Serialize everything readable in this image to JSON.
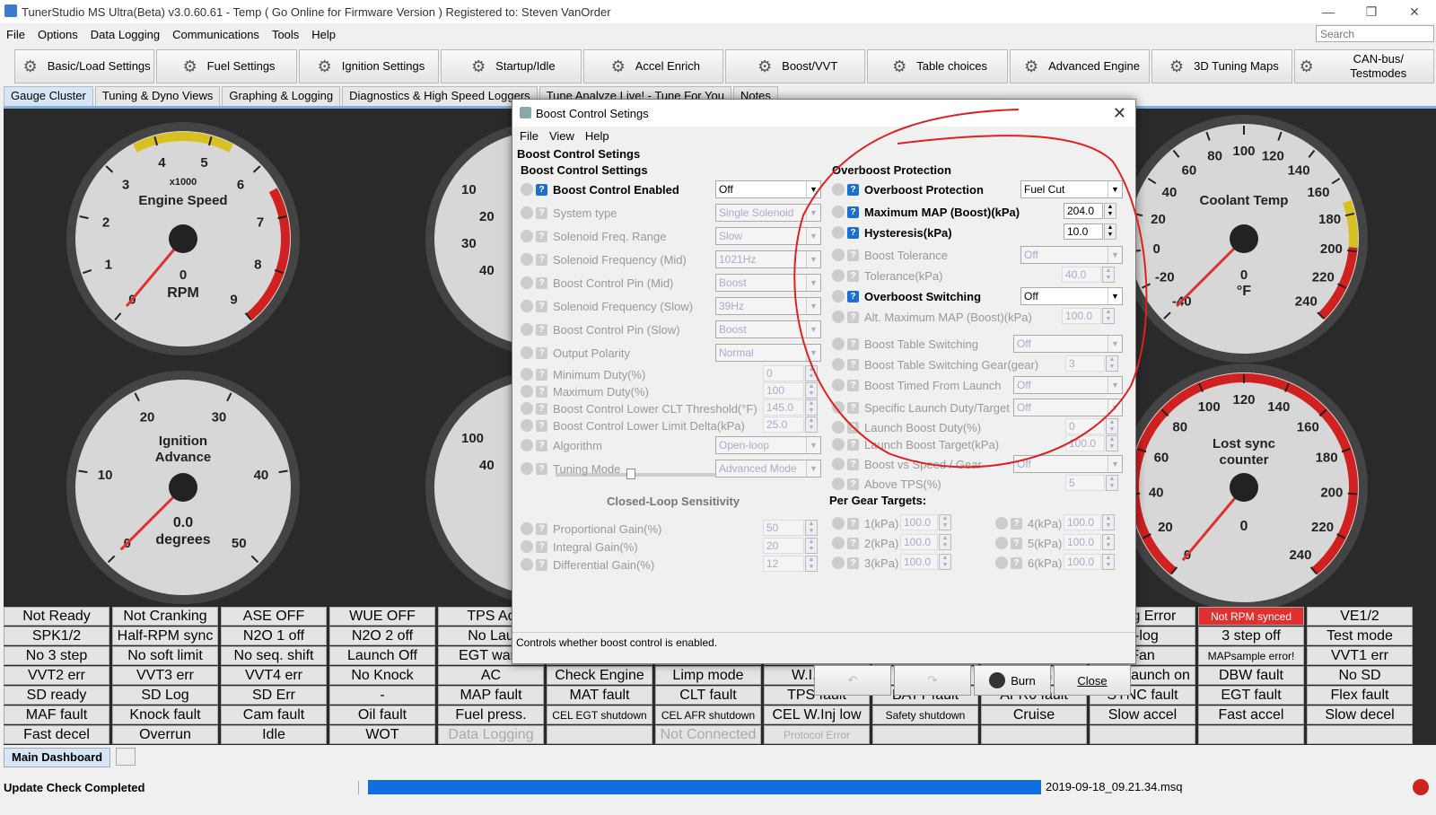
{
  "window": {
    "title": "TunerStudio MS Ultra(Beta) v3.0.60.61 - Temp ( Go Online for Firmware Version ) Registered to: Steven VanOrder",
    "minimize": "—",
    "restore": "❐",
    "close": "✕"
  },
  "menu": [
    "File",
    "Options",
    "Data Logging",
    "Communications",
    "Tools",
    "Help"
  ],
  "search_placeholder": "Search",
  "toolbar": [
    {
      "label": "Basic/Load Settings",
      "icon": "gears-icon"
    },
    {
      "label": "Fuel Settings",
      "icon": "injector-icon"
    },
    {
      "label": "Ignition Settings",
      "icon": "spark-plug-icon"
    },
    {
      "label": "Startup/Idle",
      "icon": "gauge-icon"
    },
    {
      "label": "Accel Enrich",
      "icon": "accel-icon"
    },
    {
      "label": "Boost/VVT",
      "icon": "turbo-icon"
    },
    {
      "label": "Table choices",
      "icon": "table-icon"
    },
    {
      "label": "Advanced Engine",
      "icon": "gear-icon"
    },
    {
      "label": "3D Tuning Maps",
      "icon": "wrench-icon"
    },
    {
      "label": "CAN-bus/ Testmodes",
      "icon": "network-icon"
    }
  ],
  "tabs": [
    "Gauge Cluster",
    "Tuning & Dyno Views",
    "Graphing & Logging",
    "Diagnostics & High Speed Loggers",
    "Tune Analyze Live! - Tune For You",
    "Notes"
  ],
  "gauges": {
    "rpm": {
      "title": "Engine Speed",
      "mult": "x1000",
      "value": "0",
      "unit": "RPM",
      "ticks": [
        "0",
        "1",
        "2",
        "3",
        "4",
        "5",
        "6",
        "7",
        "8",
        "9"
      ]
    },
    "advance": {
      "title": "Ignition Advance",
      "value": "0.0",
      "unit": "degrees",
      "ticks": [
        "0",
        "10",
        "20",
        "30",
        "40",
        "50"
      ]
    },
    "coolant": {
      "title": "Coolant Temp",
      "value": "0",
      "unit": "°F",
      "ticks": [
        "-40",
        "-20",
        "0",
        "20",
        "40",
        "60",
        "80",
        "100",
        "120",
        "140",
        "160",
        "180",
        "200",
        "220",
        "240"
      ]
    },
    "lostsync": {
      "title": "Lost sync counter",
      "value": "0",
      "ticks": [
        "0",
        "20",
        "40",
        "60",
        "80",
        "100",
        "120",
        "140",
        "160",
        "180",
        "200",
        "220",
        "240"
      ]
    },
    "partial_left_top": {
      "ticks": [
        "10",
        "20",
        "30",
        "40"
      ]
    },
    "partial_left_bottom": {
      "ticks": [
        "100",
        "40"
      ]
    }
  },
  "indicators": [
    [
      "Not Ready",
      "Not Cranking",
      "ASE OFF",
      "WUE OFF",
      "TPS Ac",
      "",
      "",
      "",
      "",
      "",
      "onfig Error",
      "Not RPM synced",
      "VE1/2"
    ],
    [
      "SPK1/2",
      "Half-RPM sync",
      "N2O 1 off",
      "N2O 2 off",
      "No Lau",
      "",
      "",
      "",
      "",
      "",
      "T-log",
      "3 step off",
      "Test mode"
    ],
    [
      "No 3 step",
      "No soft limit",
      "No seq. shift",
      "Launch Off",
      "EGT warn",
      "EGT shutdown",
      "AFR warn",
      "AFR shutdown",
      "Idle VE",
      "Idle Adv",
      "Fan",
      "MAPsample error!",
      "VVT1 err"
    ],
    [
      "VVT2 err",
      "VVT3 err",
      "VVT4 err",
      "No Knock",
      "AC",
      "Check Engine",
      "Limp mode",
      "W.I. low",
      "PW4X",
      "VSS launch L/O",
      "VSS launch on",
      "DBW fault",
      "No SD"
    ],
    [
      "SD ready",
      "SD Log",
      "SD Err",
      "-",
      "MAP fault",
      "MAT fault",
      "CLT fault",
      "TPS fault",
      "BATT fault",
      "AFR0 fault",
      "SYNC fault",
      "EGT fault",
      "Flex fault"
    ],
    [
      "MAF fault",
      "Knock fault",
      "Cam fault",
      "Oil fault",
      "Fuel press.",
      "CEL EGT shutdown",
      "CEL AFR shutdown",
      "CEL W.Inj low",
      "Safety shutdown",
      "Cruise",
      "Slow accel",
      "Fast accel",
      "Slow decel"
    ],
    [
      "Fast decel",
      "Overrun",
      "Idle",
      "WOT",
      "Data Logging",
      "",
      "Not Connected",
      "Protocol Error",
      "",
      "",
      "",
      "",
      ""
    ]
  ],
  "bottom_tab": "Main Dashboard",
  "status": {
    "message": "Update Check Completed",
    "file": "2019-09-18_09.21.34.msq"
  },
  "dialog": {
    "title": "Boost Control Setings",
    "menu": [
      "File",
      "View",
      "Help"
    ],
    "header": "Boost Control Setings",
    "left_title": "Boost Control Settings",
    "right_title": "Overboost Protection",
    "left_rows": [
      {
        "label": "Boost Control Enabled",
        "value": "Off",
        "kind": "combo",
        "enabled": true
      },
      {
        "label": "System type",
        "value": "Single Solenoid",
        "kind": "combo",
        "enabled": false
      },
      {
        "label": "Solenoid Freq. Range",
        "value": "Slow",
        "kind": "combo",
        "enabled": false
      },
      {
        "label": "Solenoid Frequency (Mid)",
        "value": "1021Hz",
        "kind": "combo",
        "enabled": false
      },
      {
        "label": "Boost Control Pin (Mid)",
        "value": "Boost",
        "kind": "combo",
        "enabled": false
      },
      {
        "label": "Solenoid Frequency (Slow)",
        "value": "39Hz",
        "kind": "combo",
        "enabled": false
      },
      {
        "label": "Boost Control Pin (Slow)",
        "value": "Boost",
        "kind": "combo",
        "enabled": false
      },
      {
        "label": "Output Polarity",
        "value": "Normal",
        "kind": "combo",
        "enabled": false
      },
      {
        "label": "Minimum Duty(%)",
        "value": "0",
        "kind": "spin",
        "enabled": false
      },
      {
        "label": "Maximum Duty(%)",
        "value": "100",
        "kind": "spin",
        "enabled": false
      },
      {
        "label": "Boost Control Lower CLT Threshold(°F)",
        "value": "145.0",
        "kind": "spin",
        "enabled": false
      },
      {
        "label": "Boost Control Lower Limit Delta(kPa)",
        "value": "25.0",
        "kind": "spin",
        "enabled": false
      },
      {
        "label": "Algorithm",
        "value": "Open-loop",
        "kind": "combo",
        "enabled": false
      },
      {
        "label": "Tuning Mode",
        "value": "Advanced Mode",
        "kind": "combo",
        "enabled": false
      }
    ],
    "slider_label": "Closed-Loop Sensitivity",
    "slider_value": 0.36,
    "gain_rows": [
      {
        "label": "Proportional Gain(%)",
        "value": "50"
      },
      {
        "label": "Integral Gain(%)",
        "value": "20"
      },
      {
        "label": "Differential Gain(%)",
        "value": "12"
      }
    ],
    "right_rows": [
      {
        "label": "Overboost Protection",
        "value": "Fuel Cut",
        "kind": "combo",
        "enabled": true
      },
      {
        "label": "Maximum MAP (Boost)(kPa)",
        "value": "204.0",
        "kind": "spin",
        "enabled": true
      },
      {
        "label": "Hysteresis(kPa)",
        "value": "10.0",
        "kind": "spin",
        "enabled": true
      },
      {
        "label": "Boost Tolerance",
        "value": "Off",
        "kind": "combo",
        "enabled": false
      },
      {
        "label": "Tolerance(kPa)",
        "value": "40.0",
        "kind": "spin",
        "enabled": false
      },
      {
        "label": "Overboost Switching",
        "value": "Off",
        "kind": "combo",
        "enabled": true
      },
      {
        "label": "Alt. Maximum MAP (Boost)(kPa)",
        "value": "100.0",
        "kind": "spin",
        "enabled": false
      }
    ],
    "right_rows2": [
      {
        "label": "Boost Table Switching",
        "value": "Off",
        "kind": "combo"
      },
      {
        "label": "Boost Table Switching Gear(gear)",
        "value": "3",
        "kind": "spin"
      },
      {
        "label": "Boost Timed From Launch",
        "value": "Off",
        "kind": "combo"
      },
      {
        "label": "Specific Launch Duty/Target",
        "value": "Off",
        "kind": "combo"
      },
      {
        "label": "Launch Boost Duty(%)",
        "value": "0",
        "kind": "spin"
      },
      {
        "label": "Launch Boost Target(kPa)",
        "value": "100.0",
        "kind": "spin"
      },
      {
        "label": "Boost vs Speed / Gear",
        "value": "Off",
        "kind": "combo"
      },
      {
        "label": "Above TPS(%)",
        "value": "5",
        "kind": "spin"
      }
    ],
    "per_gear_title": "Per Gear Targets:",
    "gears": [
      {
        "label": "1(kPa)",
        "value": "100.0"
      },
      {
        "label": "4(kPa)",
        "value": "100.0"
      },
      {
        "label": "2(kPa)",
        "value": "100.0"
      },
      {
        "label": "5(kPa)",
        "value": "100.0"
      },
      {
        "label": "3(kPa)",
        "value": "100.0"
      },
      {
        "label": "6(kPa)",
        "value": "100.0"
      }
    ],
    "note": "Controls whether boost control is enabled.",
    "buttons": {
      "burn": "Burn",
      "close": "Close"
    }
  }
}
